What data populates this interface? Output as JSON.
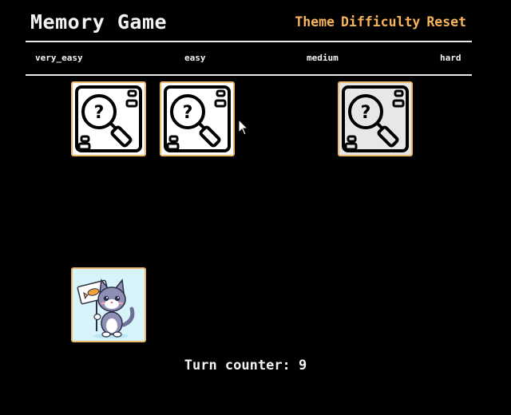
{
  "app": {
    "title": "Memory Game"
  },
  "nav": {
    "theme_label": "Theme",
    "difficulty_label": "Difficulty",
    "reset_label": "Reset"
  },
  "levels": [
    "very_easy",
    "easy",
    "medium",
    "hard"
  ],
  "cards": [
    {
      "state": "hidden",
      "icon": "search-question-icon"
    },
    {
      "state": "hidden",
      "icon": "search-question-icon"
    },
    {
      "state": "empty"
    },
    {
      "state": "hidden-dim",
      "icon": "search-question-icon"
    },
    {
      "state": "revealed",
      "icon": "cat-holding-fish-sign-icon"
    }
  ],
  "turn": {
    "label": "Turn counter:",
    "value": 9,
    "text": "Turn counter: 9"
  },
  "colors": {
    "accent": "#f7b45a",
    "card_border": "#e9b86a",
    "background": "#000000",
    "revealed_bg": "#d8f4fb"
  }
}
